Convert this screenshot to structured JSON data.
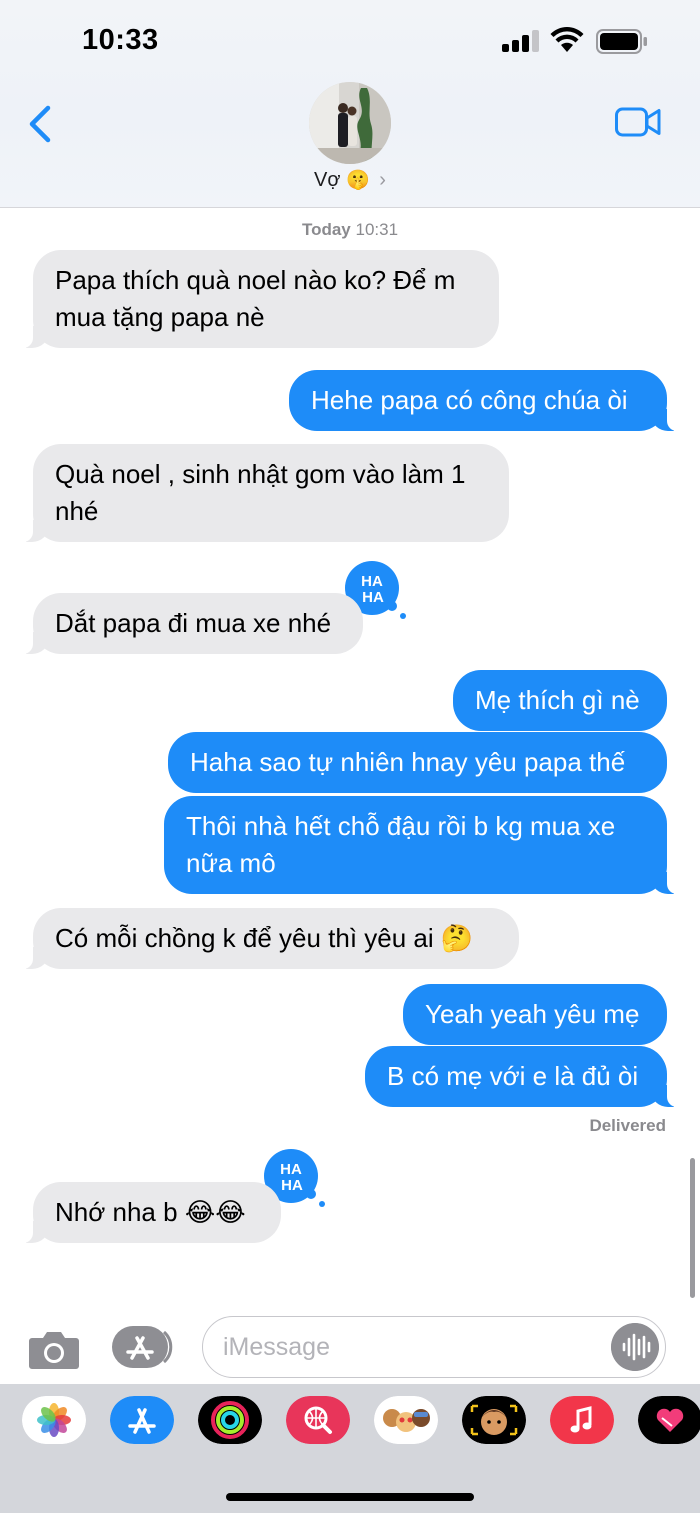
{
  "status_bar": {
    "time": "10:33"
  },
  "header": {
    "contact_name": "Vợ",
    "contact_emoji": "🤫",
    "chevron": "›",
    "icons": {
      "back": "chevron-left-icon",
      "video": "video-camera-icon"
    },
    "accent_color": "#1e8cf8"
  },
  "conversation": {
    "timestamp_day": "Today",
    "timestamp_time": "10:31",
    "messages": [
      {
        "from": "them",
        "text": "Papa thích quà noel nào ko? Để m mua tặng papa nè",
        "line1": "Papa thích quà noel nào ko? Để m",
        "line2": "mua tặng papa nè"
      },
      {
        "from": "me",
        "text": "Hehe papa có công chúa òi"
      },
      {
        "from": "them",
        "text": "Quà noel , sinh nhật gom vào làm 1 nhé",
        "line1": "Quà noel , sinh nhật gom vào làm 1",
        "line2": "nhé"
      },
      {
        "from": "them",
        "text": "Dắt papa đi mua xe nhé",
        "reaction": "HA HA"
      },
      {
        "from": "me",
        "text": "Mẹ thích gì nè"
      },
      {
        "from": "me",
        "text": "Haha sao tự nhiên hnay yêu papa thế"
      },
      {
        "from": "me",
        "text": "Thôi nhà hết chỗ đậu rồi b kg mua xe nữa mô",
        "line1": "Thôi nhà hết chỗ đậu rồi b kg mua xe",
        "line2": "nữa mô"
      },
      {
        "from": "them",
        "text": "Có mỗi chồng k để yêu thì yêu ai",
        "emoji": "🤔"
      },
      {
        "from": "me",
        "text": "Yeah yeah yêu mẹ"
      },
      {
        "from": "me",
        "text": "B có mẹ với e là đủ òi"
      },
      {
        "from": "them",
        "text": "Nhớ nha b",
        "emoji": "😂😂",
        "reaction": "HA HA"
      }
    ],
    "delivered_label": "Delivered",
    "bubble_colors": {
      "incoming": "#e9e9eb",
      "outgoing": "#1e8cf8"
    }
  },
  "input_bar": {
    "placeholder": "iMessage",
    "value": "",
    "icons": {
      "camera": "camera-icon",
      "apps": "app-store-icon",
      "audio": "audio-waveform-icon"
    }
  },
  "app_drawer": {
    "apps": [
      "photos-icon",
      "app-store-icon",
      "activity-icon",
      "web-search-icon",
      "memoji-stickers-icon",
      "animoji-icon",
      "music-icon",
      "heart-digital-touch-icon"
    ]
  }
}
